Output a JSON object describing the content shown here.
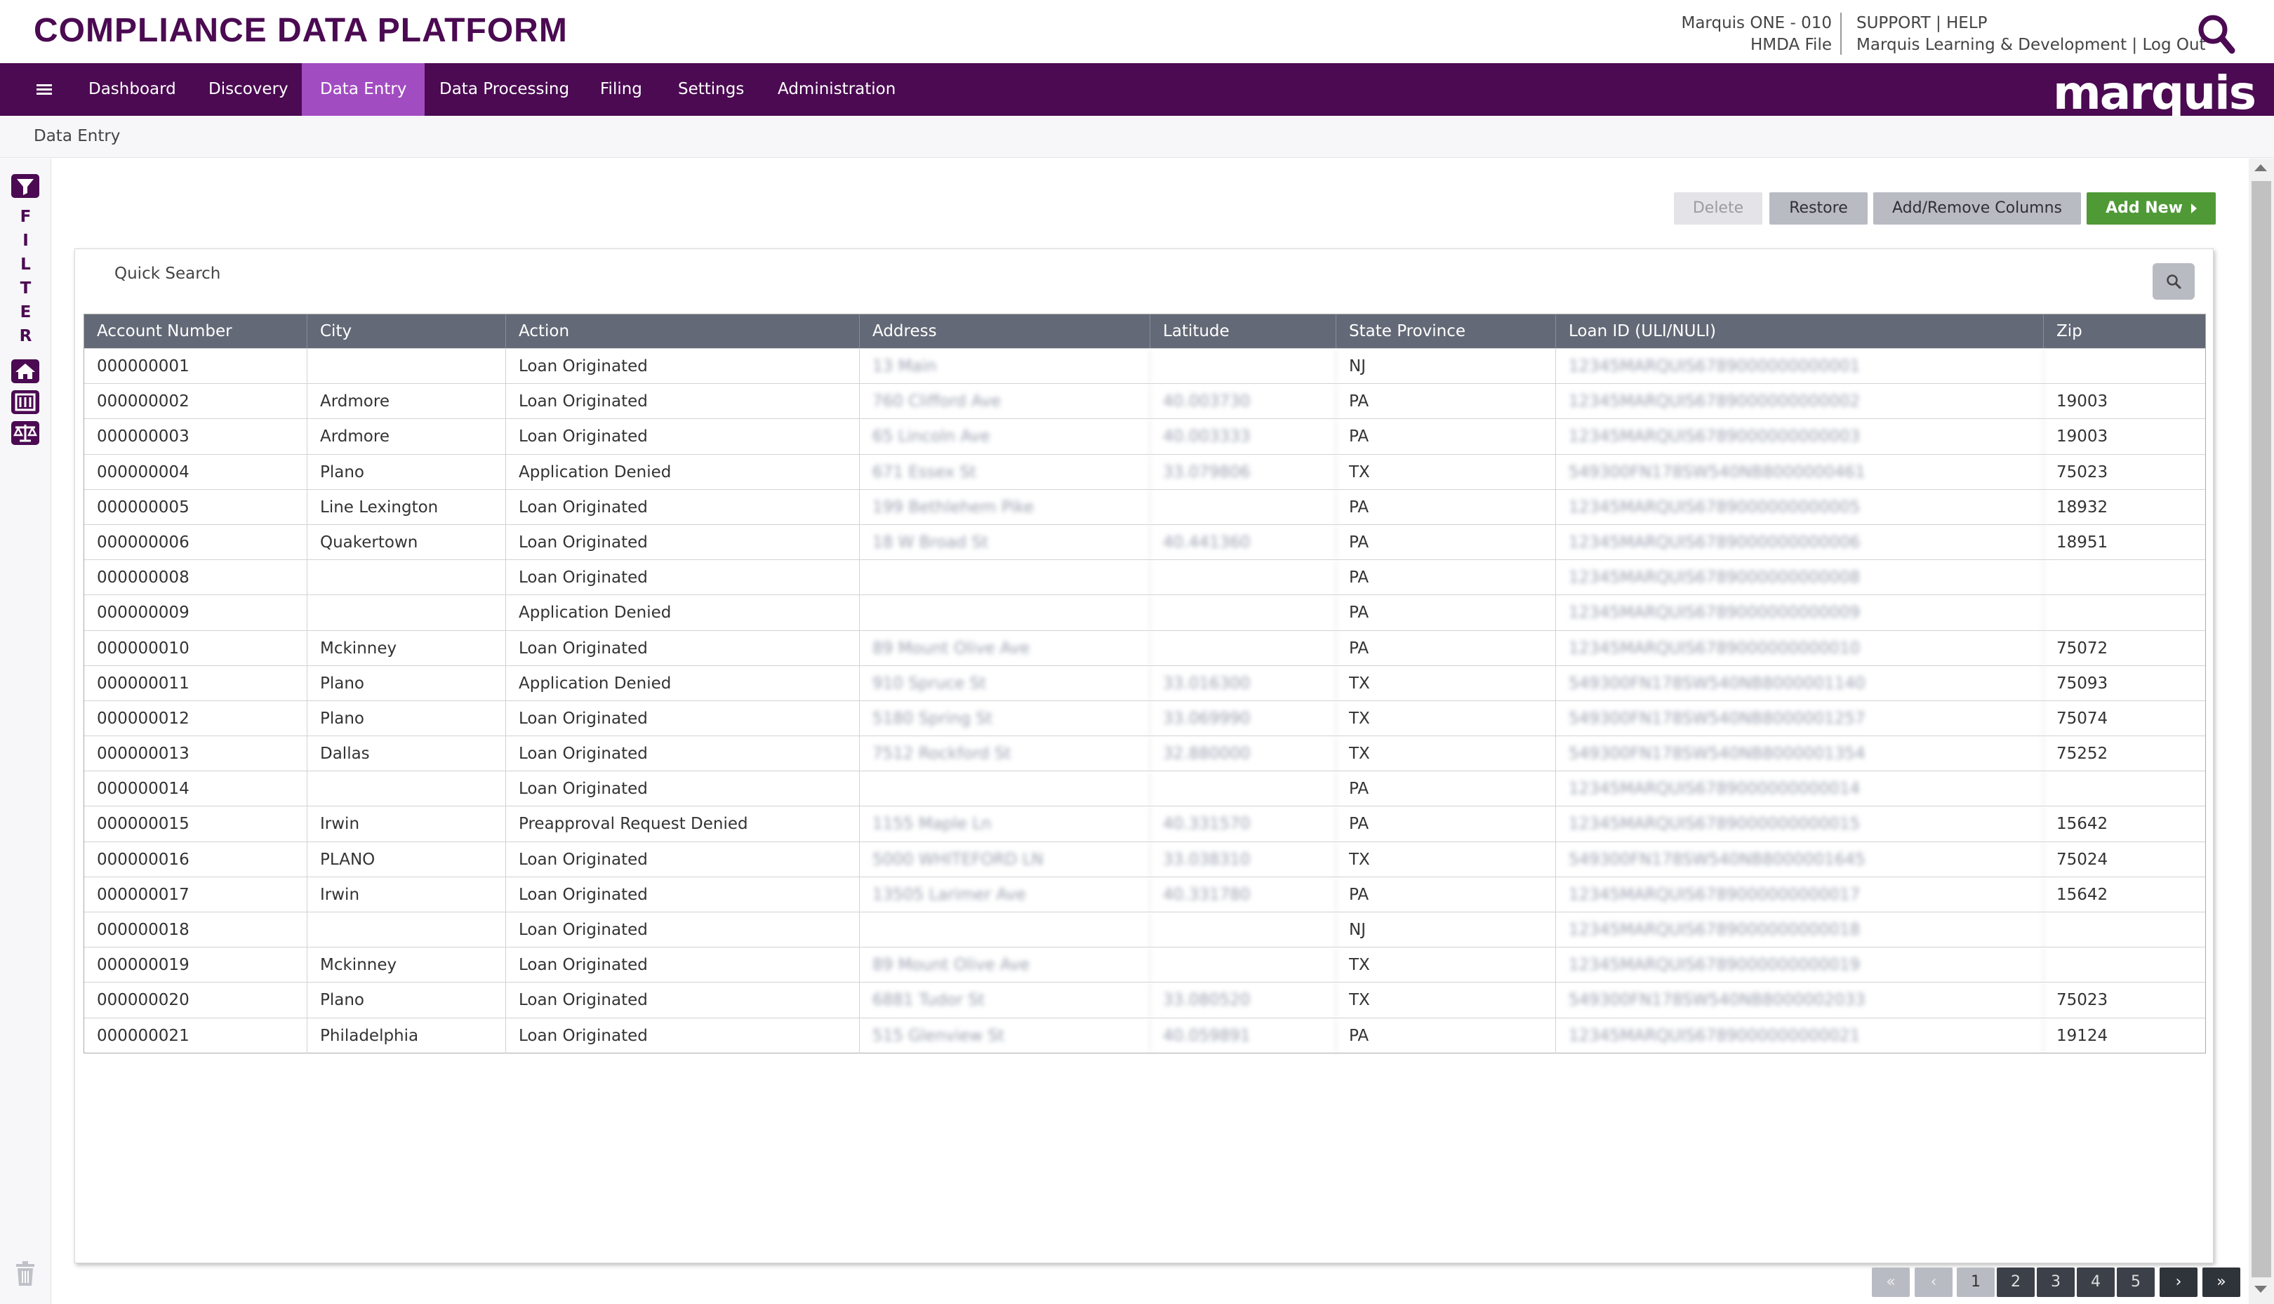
{
  "app_title": "COMPLIANCE DATA PLATFORM",
  "header": {
    "org": "Marquis ONE - 010",
    "file": "HMDA File",
    "support": "SUPPORT",
    "help": "HELP",
    "sep": "|",
    "user": "Marquis Learning & Development",
    "logout": "Log Out"
  },
  "nav": {
    "items": [
      "Dashboard",
      "Discovery",
      "Data Entry",
      "Data Processing",
      "Filing",
      "Settings",
      "Administration"
    ],
    "active": "Data Entry",
    "logo": "marquis"
  },
  "breadcrumb": "Data Entry",
  "filter_rail": {
    "letters": [
      "F",
      "I",
      "L",
      "T",
      "E",
      "R"
    ]
  },
  "toolbar": {
    "delete": "Delete",
    "restore": "Restore",
    "columns": "Add/Remove Columns",
    "add_new": "Add New"
  },
  "quick_search": {
    "label": "Quick Search"
  },
  "table": {
    "columns": [
      "Account Number",
      "City",
      "Action",
      "Address",
      "Latitude",
      "State Province",
      "Loan ID (ULI/NULI)",
      "Zip"
    ],
    "rows": [
      [
        "000000001",
        "",
        "Loan Originated",
        "13 Main",
        "",
        "NJ",
        "12345MARQUIS6789000000000001",
        ""
      ],
      [
        "000000002",
        "Ardmore",
        "Loan Originated",
        "760 Clifford Ave",
        "40.003730",
        "PA",
        "12345MARQUIS6789000000000002",
        "19003"
      ],
      [
        "000000003",
        "Ardmore",
        "Loan Originated",
        "65 Lincoln Ave",
        "40.003333",
        "PA",
        "12345MARQUIS6789000000000003",
        "19003"
      ],
      [
        "000000004",
        "Plano",
        "Application Denied",
        "671 Essex St",
        "33.079806",
        "TX",
        "549300FN178SW540NB8000000461",
        "75023"
      ],
      [
        "000000005",
        "Line Lexington",
        "Loan Originated",
        "199 Bethlehem Pike",
        "",
        "PA",
        "12345MARQUIS6789000000000005",
        "18932"
      ],
      [
        "000000006",
        "Quakertown",
        "Loan Originated",
        "18 W Broad St",
        "40.441360",
        "PA",
        "12345MARQUIS6789000000000006",
        "18951"
      ],
      [
        "000000008",
        "",
        "Loan Originated",
        "",
        "",
        "PA",
        "12345MARQUIS6789000000000008",
        ""
      ],
      [
        "000000009",
        "",
        "Application Denied",
        "",
        "",
        "PA",
        "12345MARQUIS6789000000000009",
        ""
      ],
      [
        "000000010",
        "Mckinney",
        "Loan Originated",
        "89 Mount Olive Ave",
        "",
        "PA",
        "12345MARQUIS6789000000000010",
        "75072"
      ],
      [
        "000000011",
        "Plano",
        "Application Denied",
        "910 Spruce St",
        "33.016300",
        "TX",
        "549300FN178SW540NB8000001140",
        "75093"
      ],
      [
        "000000012",
        "Plano",
        "Loan Originated",
        "5180 Spring St",
        "33.069990",
        "TX",
        "549300FN178SW540NB8000001257",
        "75074"
      ],
      [
        "000000013",
        "Dallas",
        "Loan Originated",
        "7512 Rockford St",
        "32.880000",
        "TX",
        "549300FN178SW540NB8000001354",
        "75252"
      ],
      [
        "000000014",
        "",
        "Loan Originated",
        "",
        "",
        "PA",
        "12345MARQUIS6789000000000014",
        ""
      ],
      [
        "000000015",
        "Irwin",
        "Preapproval Request Denied",
        "1155 Maple Ln",
        "40.331570",
        "PA",
        "12345MARQUIS6789000000000015",
        "15642"
      ],
      [
        "000000016",
        "PLANO",
        "Loan Originated",
        "5000 WHITEFORD LN",
        "33.038310",
        "TX",
        "549300FN178SW540NB8000001645",
        "75024"
      ],
      [
        "000000017",
        "Irwin",
        "Loan Originated",
        "13505 Larimer Ave",
        "40.331780",
        "PA",
        "12345MARQUIS6789000000000017",
        "15642"
      ],
      [
        "000000018",
        "",
        "Loan Originated",
        "",
        "",
        "NJ",
        "12345MARQUIS6789000000000018",
        ""
      ],
      [
        "000000019",
        "Mckinney",
        "Loan Originated",
        "89 Mount Olive Ave",
        "",
        "TX",
        "12345MARQUIS6789000000000019",
        ""
      ],
      [
        "000000020",
        "Plano",
        "Loan Originated",
        "6881 Tudor St",
        "33.080520",
        "TX",
        "549300FN178SW540NB8000002033",
        "75023"
      ],
      [
        "000000021",
        "Philadelphia",
        "Loan Originated",
        "515 Glenview St",
        "40.059891",
        "PA",
        "12345MARQUIS6789000000000021",
        "19124"
      ]
    ]
  },
  "pagination": {
    "first": "«",
    "prev": "‹",
    "pages": [
      "1",
      "2",
      "3",
      "4",
      "5"
    ],
    "current": "1",
    "next": "›",
    "last": "»"
  },
  "colors": {
    "brand_purple": "#4b0a52",
    "nav_active": "#a24cc2",
    "add_green": "#4f9a36",
    "table_header": "#636976"
  },
  "icons": [
    "search-icon",
    "menu-icon",
    "filter-icon",
    "home-icon",
    "building-icon",
    "balance-icon",
    "trash-icon"
  ]
}
